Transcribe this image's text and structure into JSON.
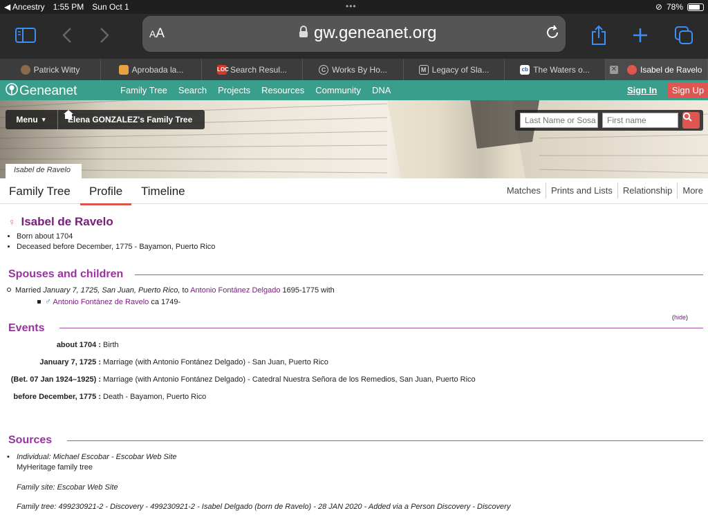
{
  "status": {
    "back_app": "◀ Ancestry",
    "time": "1:55 PM",
    "date": "Sun Oct 1",
    "battery": "78%",
    "battery_level": 0.78
  },
  "browser": {
    "aa_label": "AA",
    "host": "gw.geneanet.org"
  },
  "tabs": [
    {
      "label": "Patrick Witty",
      "icon": "avatar-icon",
      "color": "#8a6a4a"
    },
    {
      "label": "Aprobada la...",
      "icon": "image-icon",
      "color": "#e8a040"
    },
    {
      "label": "Search Resul...",
      "icon": "LOC",
      "color": "#d9362b"
    },
    {
      "label": "Works By Ho...",
      "icon": "C",
      "color": "#ffffff"
    },
    {
      "label": "Legacy of Sla...",
      "icon": "M",
      "color": "#ffffff"
    },
    {
      "label": "The Waters o...",
      "icon": "cb",
      "color": "#ffffff"
    },
    {
      "label": "Isabel de Ravelo",
      "icon": "geneanet-icon",
      "color": "#e0554f",
      "active": true
    }
  ],
  "geneanet": {
    "logo": "Geneanet",
    "menu": [
      "Family Tree",
      "Search",
      "Projects",
      "Resources",
      "Community",
      "DNA"
    ],
    "signin": "Sign In",
    "signup": "Sign Up",
    "accent": "#3a9e8c"
  },
  "hero": {
    "menu_label": "Menu",
    "tree_title": "Elena GONZALEZ's Family Tree",
    "search_last_placeholder": "Last Name or Sosa",
    "search_first_placeholder": "First name",
    "person_tag": "Isabel de Ravelo"
  },
  "profile_tabs": {
    "left": [
      "Family Tree",
      "Profile",
      "Timeline"
    ],
    "active": "Profile",
    "right": [
      "Matches",
      "Prints and Lists",
      "Relationship",
      "More"
    ]
  },
  "person": {
    "name": "Isabel de Ravelo",
    "born": "Born about 1704",
    "deceased": "Deceased before December, 1775 - Bayamon, Puerto Rico"
  },
  "spouses": {
    "heading": "Spouses and children",
    "married_prefix": "Married",
    "married_details": "January 7, 1725, San Juan, Puerto Rico,",
    "to_word": "to",
    "spouse": "Antonio Fontánez Delgado",
    "spouse_dates": "1695-1775 with",
    "child": "Antonio Fontánez de Ravelo",
    "child_dates": "ca 1749-"
  },
  "events": {
    "heading": "Events",
    "hide": "hide",
    "rows": [
      {
        "date": "about 1704 :",
        "text": "Birth"
      },
      {
        "date": "January 7, 1725 :",
        "text": "Marriage (with Antonio Fontánez Delgado) - San Juan, Puerto Rico"
      },
      {
        "date": "(Bet. 07 Jan 1924–1925) :",
        "text": "Marriage (with Antonio Fontánez Delgado) - Catedral Nuestra Señora de los Remedios, San Juan, Puerto Rico"
      },
      {
        "date": "before December, 1775 :",
        "text": "Death - Bayamon, Puerto Rico"
      }
    ]
  },
  "sources": {
    "heading": "Sources",
    "line1": "Individual: Michael Escobar - Escobar Web Site",
    "line2": "MyHeritage family tree",
    "line3": "Family site: Escobar Web Site",
    "line4": "Family tree: 499230921-2 - Discovery - 499230921-2 - Isabel Delgado (born de Ravelo) - 28 JAN 2020 - Added via a Person Discovery - Discovery"
  }
}
